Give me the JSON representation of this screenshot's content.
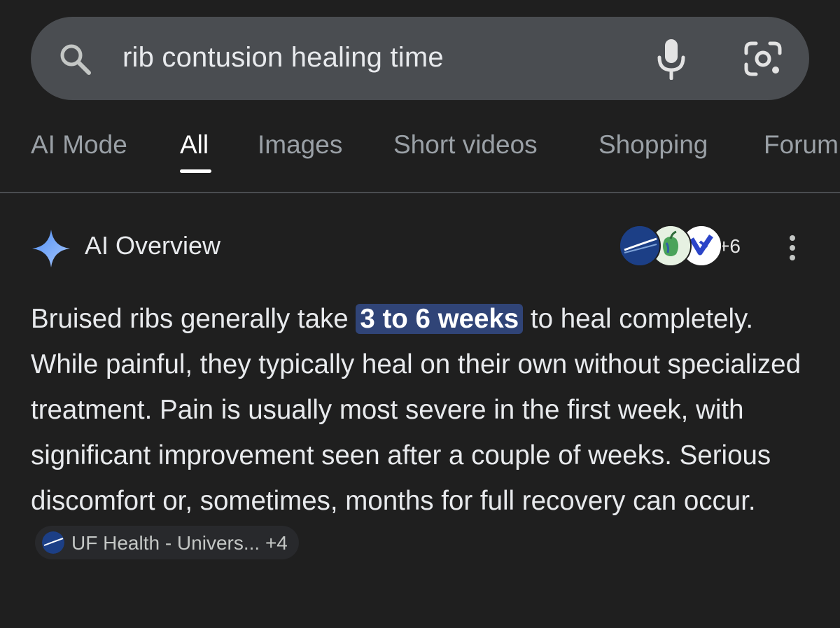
{
  "search": {
    "query": "rib contusion healing time"
  },
  "tabs": [
    {
      "label": "AI Mode"
    },
    {
      "label": "All"
    },
    {
      "label": "Images"
    },
    {
      "label": "Short videos"
    },
    {
      "label": "Shopping"
    },
    {
      "label": "Forum"
    }
  ],
  "overview": {
    "title": "AI Overview",
    "sources_count": "+6",
    "text_before": "Bruised ribs generally take ",
    "highlight": "3 to 6 weeks",
    "text_after": " to heal completely. While painful, they typically heal on their own without specialized treatment. Pain is usually most severe in the first week, with significant improvement seen after a couple of weeks. Serious discomfort or, sometimes, months for full recovery can occur.",
    "source_chip": {
      "label": "UF Health - Univers...",
      "count": "+4"
    }
  },
  "icons": {
    "search": "search-icon",
    "mic": "mic-icon",
    "lens": "google-lens-icon",
    "sparkle": "sparkle-icon",
    "more": "more-vert-icon"
  },
  "colors": {
    "background": "#1f1f1f",
    "search_bar": "#4a4d51",
    "highlight_bg": "#304477",
    "chip_bg": "#28292c"
  }
}
